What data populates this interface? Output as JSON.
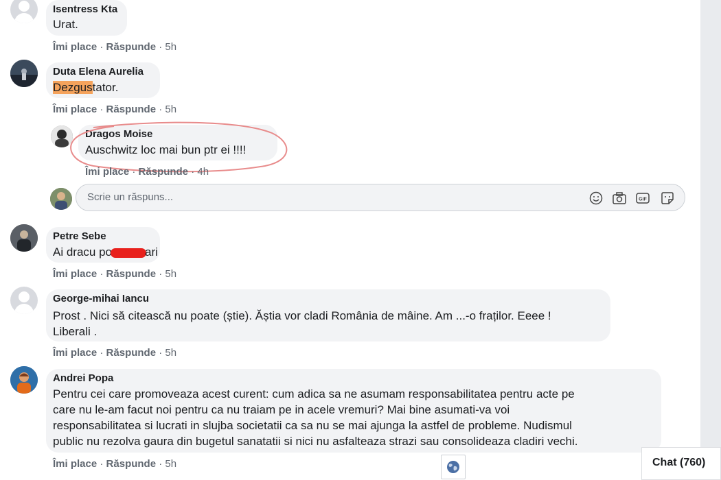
{
  "action_labels": {
    "like": "Îmi place",
    "reply": "Răspunde",
    "separator": "·"
  },
  "comments": [
    {
      "author": "Isentress Kta",
      "text": "Urat.",
      "time": "5h"
    },
    {
      "author": "Duta Elena Aurelia",
      "text_highlight": "Dezgus",
      "text_rest": "tator.",
      "time": "5h"
    },
    {
      "author": "Petre Sebe",
      "text_before": "Ai dracu po",
      "text_after": "ari",
      "time": "5h"
    },
    {
      "author": "George-mihai Iancu",
      "text_line1": "Prost . Nici să citească nu poate (știe). Ăștia vor cladi România de mâine. Am ...-o fraților. Eeee !",
      "text_line2": "Liberali .",
      "time": "5h"
    },
    {
      "author": "Andrei Popa",
      "text_lines": [
        "Pentru cei care promoveaza acest curent: cum adica sa ne asumam responsabilitatea pentru acte pe",
        "care nu le-am facut noi pentru ca nu traiam pe in acele vremuri? Mai bine asumati-va voi",
        "responsabilitatea si lucrati in slujba societatii ca sa nu se mai ajunga la astfel de probleme. Nudismul",
        "public nu rezolva gaura din bugetul sanatatii si nici nu asfalteaza strazi sau consolideaza cladiri vechi."
      ],
      "time": "5h"
    }
  ],
  "reply": {
    "author": "Dragos Moise",
    "text": "Auschwitz loc mai bun ptr ei !!!!",
    "time": "4h"
  },
  "reply_box": {
    "placeholder": "Scrie un răspuns..."
  },
  "reply_box_icons": [
    "emoji-icon",
    "camera-icon",
    "gif-icon",
    "sticker-icon"
  ],
  "chat": {
    "label": "Chat (760)"
  },
  "colors": {
    "author": "#385898",
    "bubble": "#f2f3f5",
    "meta": "#606770",
    "highlight": "#f5a35c",
    "annotation": "#e88b8b",
    "redaction": "#e8201c"
  }
}
